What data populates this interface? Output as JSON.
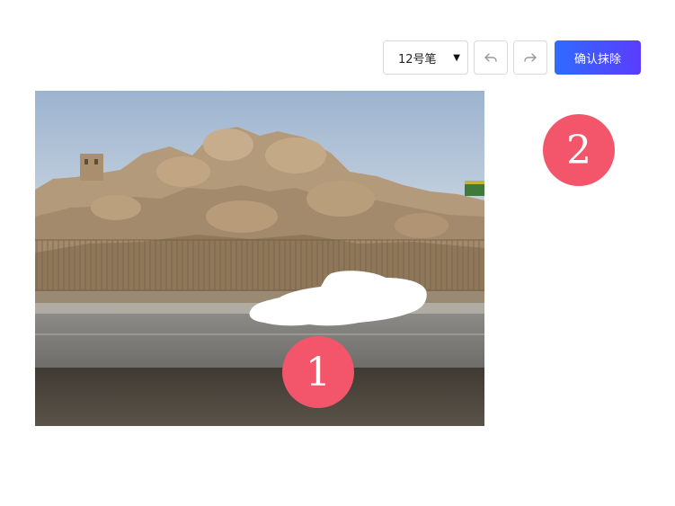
{
  "toolbar": {
    "pen_size_value": "12号笔",
    "undo_icon": "undo-icon",
    "redo_icon": "redo-icon",
    "confirm_label": "确认抹除"
  },
  "badges": {
    "one": "1",
    "two": "2"
  },
  "colors": {
    "accent_start": "#2f6bff",
    "accent_end": "#5b3cff",
    "badge": "#f3556b"
  }
}
